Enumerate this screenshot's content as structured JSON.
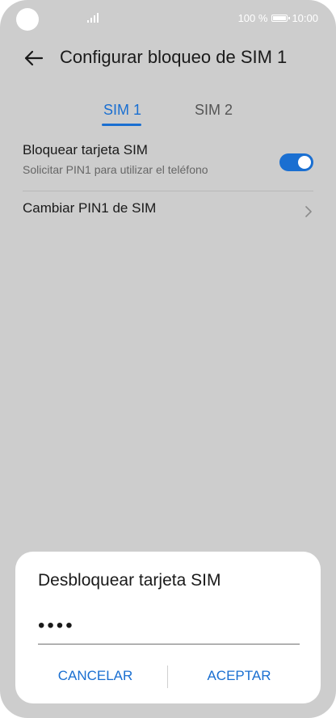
{
  "status_bar": {
    "battery_text": "100 %",
    "time": "10:00"
  },
  "header": {
    "title": "Configurar bloqueo de SIM 1",
    "back_icon": "arrow-left-icon"
  },
  "tabs": [
    {
      "label": "SIM 1",
      "active": true
    },
    {
      "label": "SIM 2",
      "active": false
    }
  ],
  "settings": {
    "lock_sim": {
      "title": "Bloquear tarjeta SIM",
      "subtitle": "Solicitar PIN1 para utilizar el teléfono",
      "enabled": true
    },
    "change_pin": {
      "title": "Cambiar PIN1 de SIM"
    }
  },
  "dialog": {
    "title": "Desbloquear tarjeta SIM",
    "pin_value": "••••",
    "cancel_label": "CANCELAR",
    "accept_label": "ACEPTAR"
  },
  "colors": {
    "accent": "#1a6fd1",
    "background": "#cdcdcd",
    "dialog": "#ffffff"
  }
}
